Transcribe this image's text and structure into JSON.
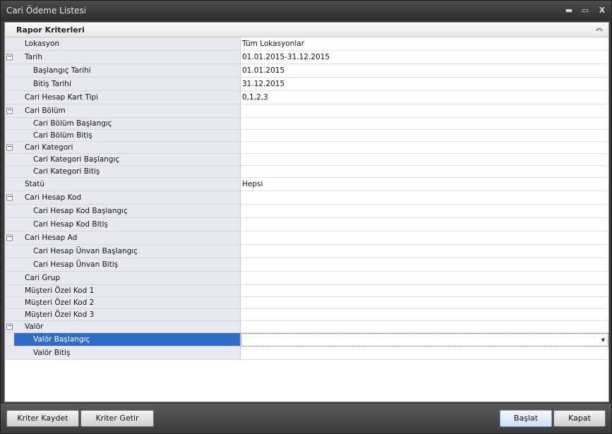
{
  "window": {
    "title": "Cari Ödeme Listesi",
    "controls": {
      "minimize": "▬",
      "maximize": "▭",
      "close": "X"
    }
  },
  "panel": {
    "title": "Rapor Kriterleri",
    "collapse_glyph": "︽"
  },
  "rows": [
    {
      "label": "Lokasyon",
      "value": "Tüm Lokasyonlar",
      "level": 0,
      "expander": ""
    },
    {
      "label": "Tarih",
      "value": "01.01.2015-31.12.2015",
      "level": 0,
      "expander": "−"
    },
    {
      "label": "Başlangıç Tarihi",
      "value": "01.01.2015",
      "level": 1,
      "expander": ""
    },
    {
      "label": "Bitiş Tarihi",
      "value": "31.12.2015",
      "level": 1,
      "expander": ""
    },
    {
      "label": "Cari Hesap Kart Tipi",
      "value": "0,1,2,3",
      "level": 0,
      "expander": ""
    },
    {
      "label": "Cari Bölüm",
      "value": "",
      "level": 0,
      "expander": "−"
    },
    {
      "label": "Cari Bölüm Başlangıç",
      "value": "",
      "level": 1,
      "expander": ""
    },
    {
      "label": "Cari Bölüm Bitiş",
      "value": "",
      "level": 1,
      "expander": ""
    },
    {
      "label": "Cari Kategori",
      "value": "",
      "level": 0,
      "expander": "−"
    },
    {
      "label": "Cari Kategori Başlangıç",
      "value": "",
      "level": 1,
      "expander": ""
    },
    {
      "label": "Cari Kategori Bitiş",
      "value": "",
      "level": 1,
      "expander": ""
    },
    {
      "label": "Statü",
      "value": "Hepsi",
      "level": 0,
      "expander": ""
    },
    {
      "label": "Cari Hesap Kod",
      "value": "",
      "level": 0,
      "expander": "−"
    },
    {
      "label": "Cari Hesap Kod Başlangıç",
      "value": "",
      "level": 1,
      "expander": ""
    },
    {
      "label": "Cari Hesap Kod Bitiş",
      "value": "",
      "level": 1,
      "expander": ""
    },
    {
      "label": "Cari Hesap Ad",
      "value": "",
      "level": 0,
      "expander": "−"
    },
    {
      "label": "Cari Hesap Ünvan Başlangıç",
      "value": "",
      "level": 1,
      "expander": ""
    },
    {
      "label": "Cari Hesap Ünvan Bitiş",
      "value": "",
      "level": 1,
      "expander": ""
    },
    {
      "label": "Cari Grup",
      "value": "",
      "level": 0,
      "expander": ""
    },
    {
      "label": "Müşteri Özel Kod 1",
      "value": "",
      "level": 0,
      "expander": ""
    },
    {
      "label": "Müşteri Özel Kod 2",
      "value": "",
      "level": 0,
      "expander": ""
    },
    {
      "label": "Müşteri Özel Kod 3",
      "value": "",
      "level": 0,
      "expander": ""
    },
    {
      "label": "Valör",
      "value": "",
      "level": 0,
      "expander": "−"
    },
    {
      "label": "Valör Başlangıç",
      "value": "",
      "level": 1,
      "expander": "",
      "selected": true,
      "dropdown": "▼"
    },
    {
      "label": "Valör Bitiş",
      "value": "",
      "level": 1,
      "expander": ""
    }
  ],
  "footer": {
    "save_criteria": "Kriter Kaydet",
    "load_criteria": "Kriter Getir",
    "start": "Başlat",
    "close": "Kapat"
  },
  "colors": {
    "selection": "#2f6bc8",
    "label_bg": "#e8e9f0",
    "title_bar": "#3a3a3a"
  }
}
